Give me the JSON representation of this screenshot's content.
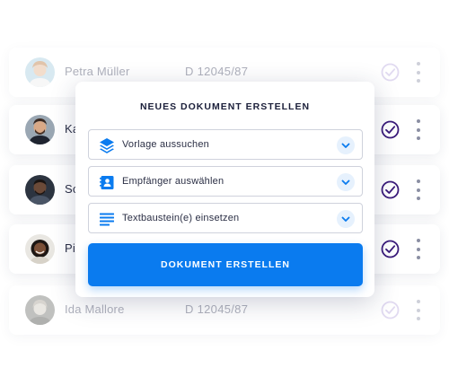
{
  "rows": [
    {
      "name": "Petra Müller",
      "doc": "D 12045/87",
      "faded": true,
      "avatar": "avatar-petra"
    },
    {
      "name": "Ka",
      "doc": "",
      "faded": false,
      "avatar": "avatar-man-beard"
    },
    {
      "name": "So",
      "doc": "",
      "faded": false,
      "avatar": "avatar-man-dark"
    },
    {
      "name": "Pi",
      "doc": "",
      "faded": false,
      "avatar": "avatar-man-curly"
    },
    {
      "name": "Ida Mallore",
      "doc": "D 12045/87",
      "faded": true,
      "avatar": "avatar-ida"
    }
  ],
  "modal": {
    "title": "NEUES DOKUMENT ERSTELLEN",
    "options": [
      {
        "label": "Vorlage aussuchen",
        "icon": "layers-icon"
      },
      {
        "label": "Empfänger auswählen",
        "icon": "contact-card-icon"
      },
      {
        "label": "Textbaustein(e) einsetzen",
        "icon": "text-lines-icon"
      }
    ],
    "button": "DOKUMENT ERSTELLEN"
  },
  "colors": {
    "accent": "#0a7bef",
    "check_active": "#3a1a7a",
    "check_faded": "#c9bde6",
    "chevron_bg": "#e6f1fd"
  }
}
